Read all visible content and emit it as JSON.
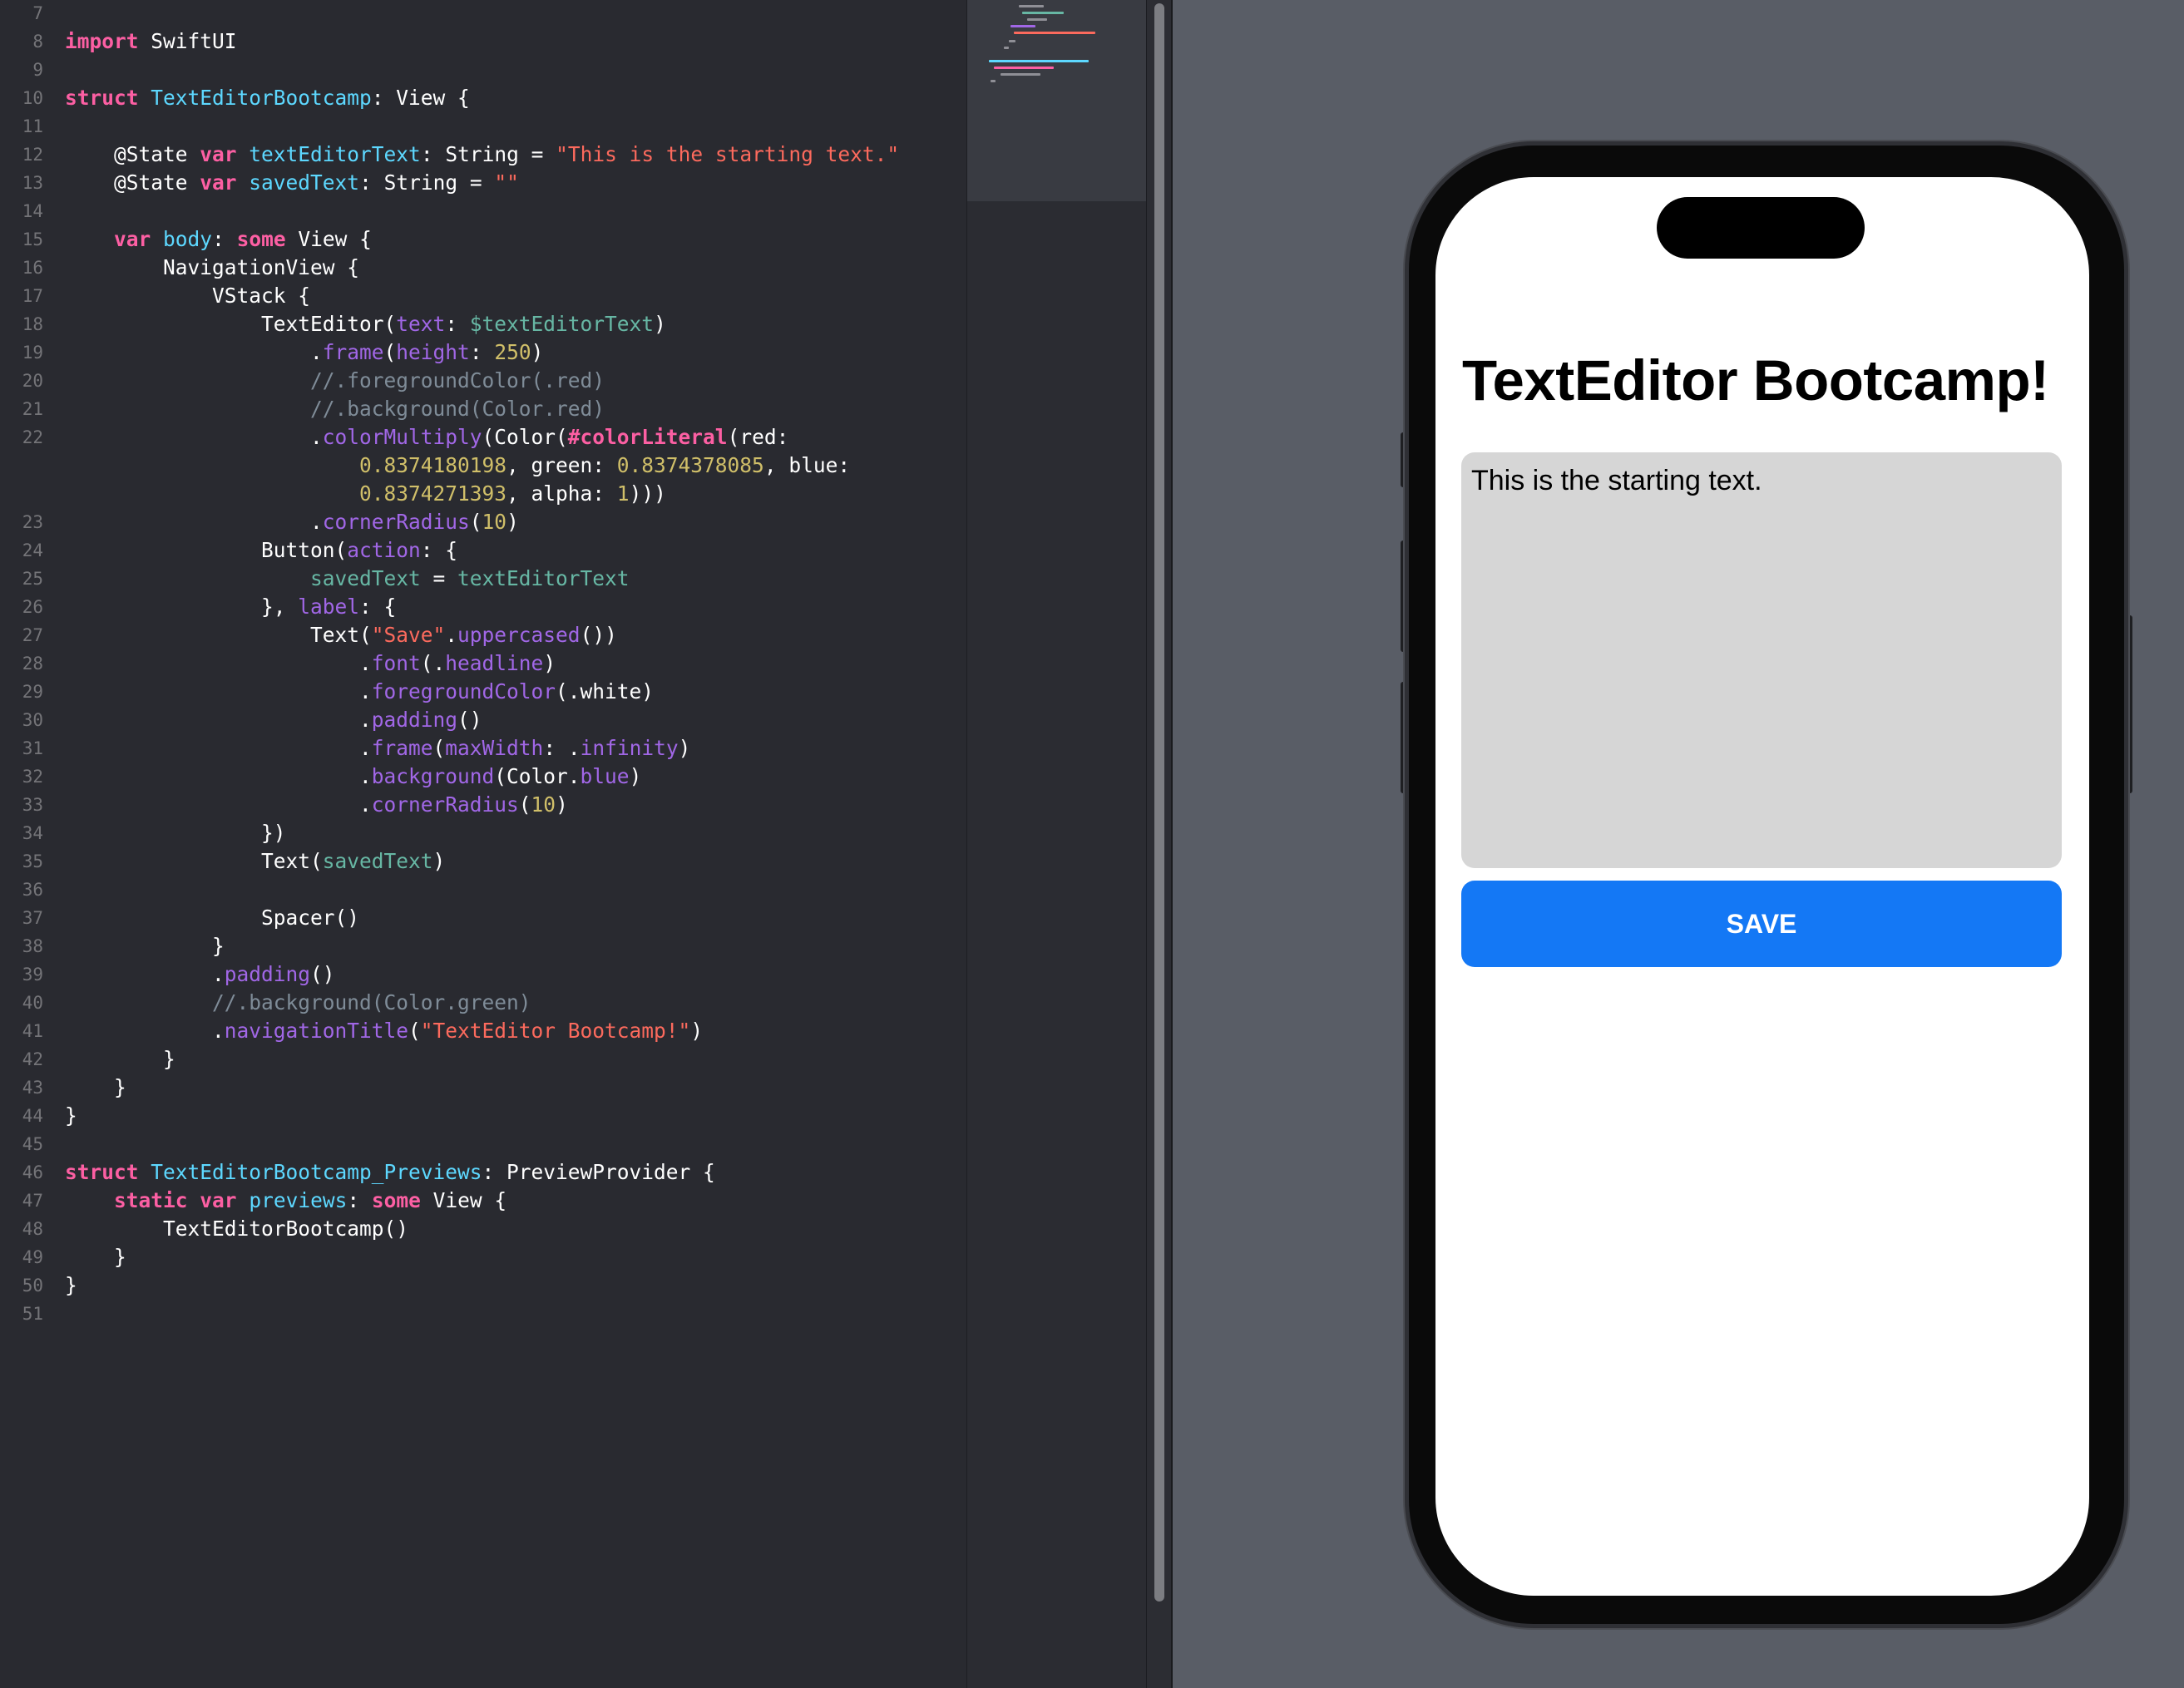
{
  "editor": {
    "lines": [
      {
        "n": "7",
        "wrap": false,
        "tokens": []
      },
      {
        "n": "8",
        "wrap": false,
        "tokens": [
          [
            "kw",
            "import"
          ],
          [
            "p",
            " SwiftUI"
          ]
        ]
      },
      {
        "n": "9",
        "wrap": false,
        "tokens": []
      },
      {
        "n": "10",
        "wrap": false,
        "tokens": [
          [
            "kw",
            "struct"
          ],
          [
            "p",
            " "
          ],
          [
            "tn",
            "TextEditorBootcamp"
          ],
          [
            "p",
            ": View {"
          ]
        ]
      },
      {
        "n": "11",
        "wrap": false,
        "tokens": []
      },
      {
        "n": "12",
        "wrap": false,
        "tokens": [
          [
            "p",
            "    @State "
          ],
          [
            "kw",
            "var"
          ],
          [
            "p",
            " "
          ],
          [
            "tn",
            "textEditorText"
          ],
          [
            "p",
            ": String = "
          ],
          [
            "str",
            "\"This is the starting text.\""
          ]
        ]
      },
      {
        "n": "13",
        "wrap": false,
        "tokens": [
          [
            "p",
            "    @State "
          ],
          [
            "kw",
            "var"
          ],
          [
            "p",
            " "
          ],
          [
            "tn",
            "savedText"
          ],
          [
            "p",
            ": String = "
          ],
          [
            "str",
            "\"\""
          ]
        ]
      },
      {
        "n": "14",
        "wrap": false,
        "tokens": []
      },
      {
        "n": "15",
        "wrap": false,
        "tokens": [
          [
            "p",
            "    "
          ],
          [
            "kw",
            "var"
          ],
          [
            "p",
            " "
          ],
          [
            "tn",
            "body"
          ],
          [
            "p",
            ": "
          ],
          [
            "kw",
            "some"
          ],
          [
            "p",
            " View {"
          ]
        ]
      },
      {
        "n": "16",
        "wrap": false,
        "tokens": [
          [
            "p",
            "        NavigationView {"
          ]
        ]
      },
      {
        "n": "17",
        "wrap": false,
        "tokens": [
          [
            "p",
            "            VStack {"
          ]
        ]
      },
      {
        "n": "18",
        "wrap": false,
        "tokens": [
          [
            "p",
            "                TextEditor("
          ],
          [
            "fn",
            "text"
          ],
          [
            "p",
            ": "
          ],
          [
            "pv",
            "$textEditorText"
          ],
          [
            "p",
            ")"
          ]
        ]
      },
      {
        "n": "19",
        "wrap": false,
        "tokens": [
          [
            "p",
            "                    ."
          ],
          [
            "fn",
            "frame"
          ],
          [
            "p",
            "("
          ],
          [
            "fn",
            "height"
          ],
          [
            "p",
            ": "
          ],
          [
            "num",
            "250"
          ],
          [
            "p",
            ")"
          ]
        ]
      },
      {
        "n": "20",
        "wrap": false,
        "tokens": [
          [
            "cm",
            "                    //.foregroundColor(.red)"
          ]
        ]
      },
      {
        "n": "21",
        "wrap": false,
        "tokens": [
          [
            "cm",
            "                    //.background(Color.red)"
          ]
        ]
      },
      {
        "n": "22",
        "wrap": false,
        "tokens": [
          [
            "p",
            "                    ."
          ],
          [
            "fn",
            "colorMultiply"
          ],
          [
            "p",
            "(Color("
          ],
          [
            "kw",
            "#colorLiteral"
          ],
          [
            "p",
            "(red:"
          ]
        ]
      },
      {
        "n": "",
        "wrap": true,
        "tokens": [
          [
            "p",
            "                        "
          ],
          [
            "num",
            "0.8374180198"
          ],
          [
            "p",
            ", green: "
          ],
          [
            "num",
            "0.8374378085"
          ],
          [
            "p",
            ", blue:"
          ]
        ]
      },
      {
        "n": "",
        "wrap": true,
        "tokens": [
          [
            "p",
            "                        "
          ],
          [
            "num",
            "0.8374271393"
          ],
          [
            "p",
            ", alpha: "
          ],
          [
            "num",
            "1"
          ],
          [
            "p",
            ")))"
          ]
        ]
      },
      {
        "n": "23",
        "wrap": false,
        "tokens": [
          [
            "p",
            "                    ."
          ],
          [
            "fn",
            "cornerRadius"
          ],
          [
            "p",
            "("
          ],
          [
            "num",
            "10"
          ],
          [
            "p",
            ")"
          ]
        ]
      },
      {
        "n": "24",
        "wrap": false,
        "tokens": [
          [
            "p",
            "                Button("
          ],
          [
            "fn",
            "action"
          ],
          [
            "p",
            ": {"
          ]
        ]
      },
      {
        "n": "25",
        "wrap": false,
        "tokens": [
          [
            "p",
            "                    "
          ],
          [
            "pv",
            "savedText"
          ],
          [
            "p",
            " = "
          ],
          [
            "pv",
            "textEditorText"
          ]
        ]
      },
      {
        "n": "26",
        "wrap": false,
        "tokens": [
          [
            "p",
            "                }, "
          ],
          [
            "fn",
            "label"
          ],
          [
            "p",
            ": {"
          ]
        ]
      },
      {
        "n": "27",
        "wrap": false,
        "tokens": [
          [
            "p",
            "                    Text("
          ],
          [
            "str",
            "\"Save\""
          ],
          [
            "p",
            "."
          ],
          [
            "fn",
            "uppercased"
          ],
          [
            "p",
            "())"
          ]
        ]
      },
      {
        "n": "28",
        "wrap": false,
        "tokens": [
          [
            "p",
            "                        ."
          ],
          [
            "fn",
            "font"
          ],
          [
            "p",
            "(."
          ],
          [
            "fn",
            "headline"
          ],
          [
            "p",
            ")"
          ]
        ]
      },
      {
        "n": "29",
        "wrap": false,
        "tokens": [
          [
            "p",
            "                        ."
          ],
          [
            "fn",
            "foregroundColor"
          ],
          [
            "p",
            "(.white)"
          ]
        ]
      },
      {
        "n": "30",
        "wrap": false,
        "tokens": [
          [
            "p",
            "                        ."
          ],
          [
            "fn",
            "padding"
          ],
          [
            "p",
            "()"
          ]
        ]
      },
      {
        "n": "31",
        "wrap": false,
        "tokens": [
          [
            "p",
            "                        ."
          ],
          [
            "fn",
            "frame"
          ],
          [
            "p",
            "("
          ],
          [
            "fn",
            "maxWidth"
          ],
          [
            "p",
            ": ."
          ],
          [
            "fn",
            "infinity"
          ],
          [
            "p",
            ")"
          ]
        ]
      },
      {
        "n": "32",
        "wrap": false,
        "tokens": [
          [
            "p",
            "                        ."
          ],
          [
            "fn",
            "background"
          ],
          [
            "p",
            "(Color."
          ],
          [
            "fn",
            "blue"
          ],
          [
            "p",
            ")"
          ]
        ]
      },
      {
        "n": "33",
        "wrap": false,
        "tokens": [
          [
            "p",
            "                        ."
          ],
          [
            "fn",
            "cornerRadius"
          ],
          [
            "p",
            "("
          ],
          [
            "num",
            "10"
          ],
          [
            "p",
            ")"
          ]
        ]
      },
      {
        "n": "34",
        "wrap": false,
        "tokens": [
          [
            "p",
            "                })"
          ]
        ]
      },
      {
        "n": "35",
        "wrap": false,
        "tokens": [
          [
            "p",
            "                Text("
          ],
          [
            "pv",
            "savedText"
          ],
          [
            "p",
            ")"
          ]
        ]
      },
      {
        "n": "36",
        "wrap": false,
        "tokens": []
      },
      {
        "n": "37",
        "wrap": false,
        "tokens": [
          [
            "p",
            "                Spacer()"
          ]
        ]
      },
      {
        "n": "38",
        "wrap": false,
        "tokens": [
          [
            "p",
            "            }"
          ]
        ]
      },
      {
        "n": "39",
        "wrap": false,
        "tokens": [
          [
            "p",
            "            ."
          ],
          [
            "fn",
            "padding"
          ],
          [
            "p",
            "()"
          ]
        ]
      },
      {
        "n": "40",
        "wrap": false,
        "tokens": [
          [
            "cm",
            "            //.background(Color.green)"
          ]
        ]
      },
      {
        "n": "41",
        "wrap": false,
        "tokens": [
          [
            "p",
            "            ."
          ],
          [
            "fn",
            "navigationTitle"
          ],
          [
            "p",
            "("
          ],
          [
            "str",
            "\"TextEditor Bootcamp!\""
          ],
          [
            "p",
            ")"
          ]
        ]
      },
      {
        "n": "42",
        "wrap": false,
        "tokens": [
          [
            "p",
            "        }"
          ]
        ]
      },
      {
        "n": "43",
        "wrap": false,
        "tokens": [
          [
            "p",
            "    }"
          ]
        ]
      },
      {
        "n": "44",
        "wrap": false,
        "tokens": [
          [
            "p",
            "}"
          ]
        ]
      },
      {
        "n": "45",
        "wrap": false,
        "tokens": []
      },
      {
        "n": "46",
        "wrap": false,
        "tokens": [
          [
            "kw",
            "struct"
          ],
          [
            "p",
            " "
          ],
          [
            "tn",
            "TextEditorBootcamp_Previews"
          ],
          [
            "p",
            ": PreviewProvider {"
          ]
        ]
      },
      {
        "n": "47",
        "wrap": false,
        "tokens": [
          [
            "p",
            "    "
          ],
          [
            "kw",
            "static"
          ],
          [
            "p",
            " "
          ],
          [
            "kw",
            "var"
          ],
          [
            "p",
            " "
          ],
          [
            "tn",
            "previews"
          ],
          [
            "p",
            ": "
          ],
          [
            "kw",
            "some"
          ],
          [
            "p",
            " View {"
          ]
        ]
      },
      {
        "n": "48",
        "wrap": false,
        "tokens": [
          [
            "p",
            "        TextEditorBootcamp()"
          ]
        ]
      },
      {
        "n": "49",
        "wrap": false,
        "tokens": [
          [
            "p",
            "    }"
          ]
        ]
      },
      {
        "n": "50",
        "wrap": false,
        "tokens": [
          [
            "p",
            "}"
          ]
        ]
      },
      {
        "n": "51",
        "wrap": false,
        "tokens": []
      }
    ]
  },
  "colors": {
    "editor_background": "#292a30",
    "keyword": "#fc5fa3",
    "type_declaration": "#5dd8ff",
    "function_call": "#a167e6",
    "string": "#fc6a5d",
    "number": "#d0bf69",
    "comment": "#7f8c98",
    "project_variable": "#67b7a4",
    "preview_canvas": "#595d66",
    "save_button": "#1478f5",
    "text_editor_fill": "#d6d6d6"
  },
  "preview": {
    "navigation_title": "TextEditor Bootcamp!",
    "text_editor_value": "This is the starting text.",
    "save_button_label": "SAVE"
  }
}
